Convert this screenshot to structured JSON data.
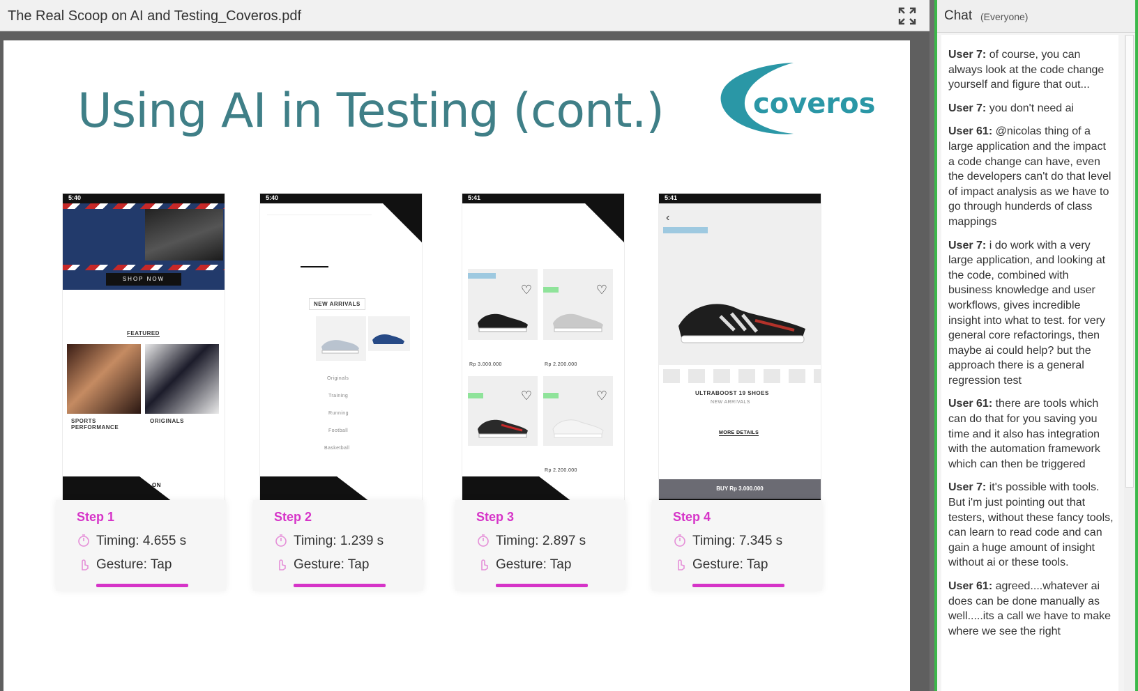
{
  "document": {
    "filename": "The Real Scoop on AI and Testing_Coveros.pdf",
    "fullscreen_icon": "fullscreen-icon",
    "slide": {
      "title": "Using AI in Testing (cont.)",
      "logo_text": "coveros",
      "colors": {
        "title": "#3f7f87",
        "accent": "#d634c8",
        "logo": "#2a97a6"
      },
      "steps": [
        {
          "label": "Step 1",
          "timing": "Timing: 4.655 s",
          "gesture": "Gesture: Tap",
          "screen": {
            "time": "5:40",
            "banner_button": "SHOP NOW",
            "section": "FEATURED",
            "tile1": "SPORTS PERFORMANCE",
            "tile2": "ORIGINALS",
            "bottom_text": "ON"
          }
        },
        {
          "label": "Step 2",
          "timing": "Timing: 1.239 s",
          "gesture": "Gesture: Tap",
          "screen": {
            "time": "5:40",
            "heading": "NEW ARRIVALS",
            "menu": [
              "Originals",
              "Training",
              "Running",
              "Football",
              "Basketball"
            ]
          }
        },
        {
          "label": "Step 3",
          "timing": "Timing: 2.897 s",
          "gesture": "Gesture: Tap",
          "screen": {
            "time": "5:41",
            "prices": [
              "Rp 3.000.000",
              "Rp 2.200.000",
              "Rp 2.200.000"
            ]
          }
        },
        {
          "label": "Step 4",
          "timing": "Timing: 7.345 s",
          "gesture": "Gesture: Tap",
          "screen": {
            "time": "5:41",
            "product": "ULTRABOOST 19 SHOES",
            "subtitle": "NEW ARRIVALS",
            "link": "MORE DETAILS",
            "buy": "BUY Rp 3.000.000"
          }
        }
      ]
    }
  },
  "chat": {
    "title": "Chat",
    "scope": "(Everyone)",
    "messages": [
      {
        "user": "User 7:",
        "text": "of course, you can always look at the code change yourself and figure that out..."
      },
      {
        "user": "User 7:",
        "text": "you don't need ai"
      },
      {
        "user": "User 61:",
        "text": "@nicolas thing of a large application and the impact a code change can have, even the developers can't do that level of impact analysis as we have to go through hunderds of class mappings"
      },
      {
        "user": "User 7:",
        "text": "i do work with a very large application, and looking at the code, combined with business knowledge and user workflows, gives incredible insight into what to test. for very general core refactorings, then maybe ai could help? but the approach there is a general regression test"
      },
      {
        "user": "User 61:",
        "text": "there are tools which can do that for you saving you time and it also has integration with the automation framework which can then be triggered"
      },
      {
        "user": "User 7:",
        "text": "it's possible with tools. But i'm just pointing out that testers, without these fancy tools, can learn to read code and can gain a huge amount of insight without ai or these tools."
      },
      {
        "user": "User 61:",
        "text": "agreed....whatever ai does can be done manually as well.....its a call we have to make where we see the right"
      }
    ]
  }
}
